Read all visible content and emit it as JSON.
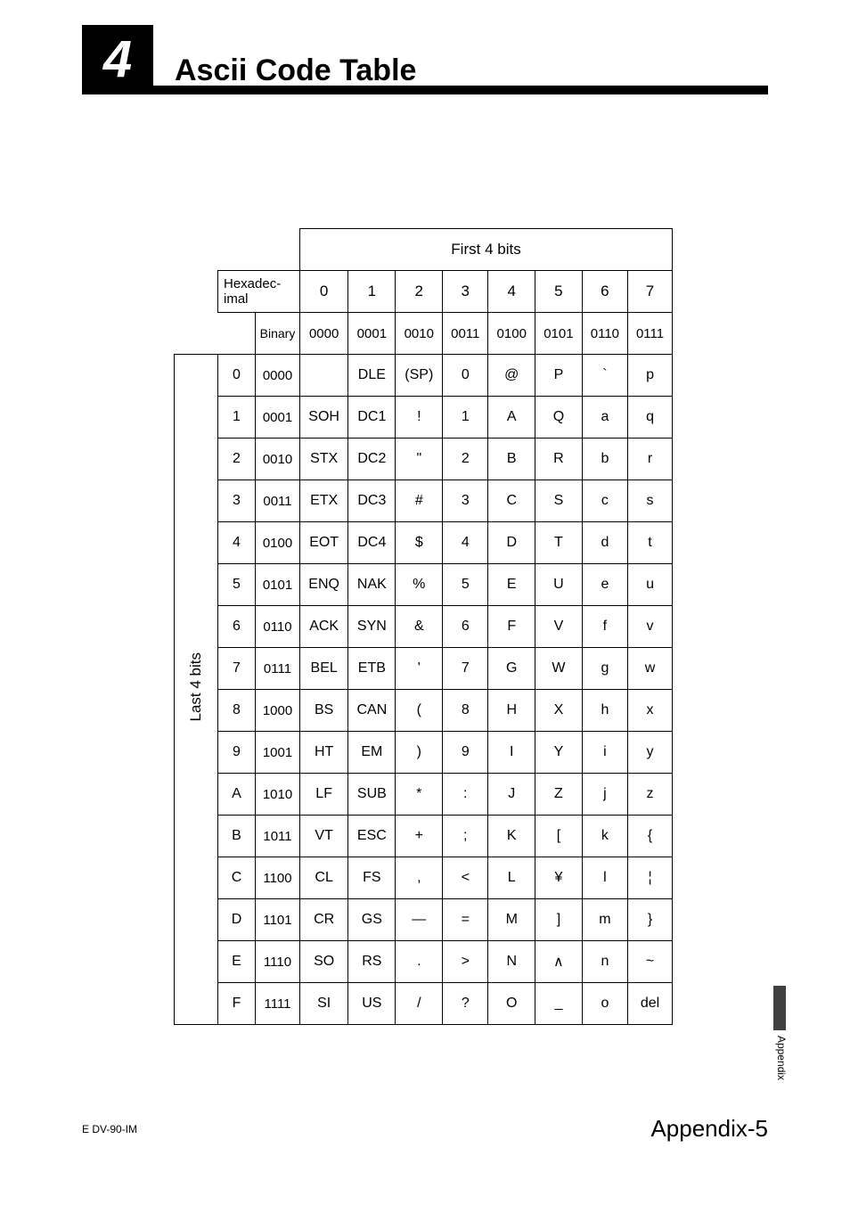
{
  "chapter_number": "4",
  "title": "Ascii Code Table",
  "table": {
    "first4_label": "First 4 bits",
    "last4_label": "Last 4 bits",
    "hex_label": "Hexadec-\nimal",
    "binary_label": "Binary",
    "col_hex": [
      "0",
      "1",
      "2",
      "3",
      "4",
      "5",
      "6",
      "7"
    ],
    "col_bin": [
      "0000",
      "0001",
      "0010",
      "0011",
      "0100",
      "0101",
      "0110",
      "0111"
    ],
    "rows": [
      {
        "hex": "0",
        "bin": "0000",
        "cells": [
          "",
          "DLE",
          "(SP)",
          "0",
          "@",
          "P",
          "`",
          "p"
        ]
      },
      {
        "hex": "1",
        "bin": "0001",
        "cells": [
          "SOH",
          "DC1",
          "!",
          "1",
          "A",
          "Q",
          "a",
          "q"
        ]
      },
      {
        "hex": "2",
        "bin": "0010",
        "cells": [
          "STX",
          "DC2",
          "\"",
          "2",
          "B",
          "R",
          "b",
          "r"
        ]
      },
      {
        "hex": "3",
        "bin": "0011",
        "cells": [
          "ETX",
          "DC3",
          "#",
          "3",
          "C",
          "S",
          "c",
          "s"
        ]
      },
      {
        "hex": "4",
        "bin": "0100",
        "cells": [
          "EOT",
          "DC4",
          "$",
          "4",
          "D",
          "T",
          "d",
          "t"
        ]
      },
      {
        "hex": "5",
        "bin": "0101",
        "cells": [
          "ENQ",
          "NAK",
          "%",
          "5",
          "E",
          "U",
          "e",
          "u"
        ]
      },
      {
        "hex": "6",
        "bin": "0110",
        "cells": [
          "ACK",
          "SYN",
          "&",
          "6",
          "F",
          "V",
          "f",
          "v"
        ]
      },
      {
        "hex": "7",
        "bin": "0111",
        "cells": [
          "BEL",
          "ETB",
          "'",
          "7",
          "G",
          "W",
          "g",
          "w"
        ]
      },
      {
        "hex": "8",
        "bin": "1000",
        "cells": [
          "BS",
          "CAN",
          "(",
          "8",
          "H",
          "X",
          "h",
          "x"
        ]
      },
      {
        "hex": "9",
        "bin": "1001",
        "cells": [
          "HT",
          "EM",
          ")",
          "9",
          "I",
          "Y",
          "i",
          "y"
        ]
      },
      {
        "hex": "A",
        "bin": "1010",
        "cells": [
          "LF",
          "SUB",
          "*",
          ":",
          "J",
          "Z",
          "j",
          "z"
        ]
      },
      {
        "hex": "B",
        "bin": "1011",
        "cells": [
          "VT",
          "ESC",
          "+",
          ";",
          "K",
          "[",
          "k",
          "{"
        ]
      },
      {
        "hex": "C",
        "bin": "1100",
        "cells": [
          "CL",
          "FS",
          ",",
          "<",
          "L",
          "¥",
          "l",
          "¦"
        ]
      },
      {
        "hex": "D",
        "bin": "1101",
        "cells": [
          "CR",
          "GS",
          "—",
          "=",
          "M",
          "]",
          "m",
          "}"
        ]
      },
      {
        "hex": "E",
        "bin": "1110",
        "cells": [
          "SO",
          "RS",
          ".",
          ">",
          "N",
          "∧",
          "n",
          "~"
        ]
      },
      {
        "hex": "F",
        "bin": "1111",
        "cells": [
          "SI",
          "US",
          "/",
          "?",
          "O",
          "_",
          "o",
          "del"
        ]
      }
    ]
  },
  "side_tab_label": "Appendix",
  "footer_left": "E DV-90-IM",
  "footer_right": "Appendix-5"
}
